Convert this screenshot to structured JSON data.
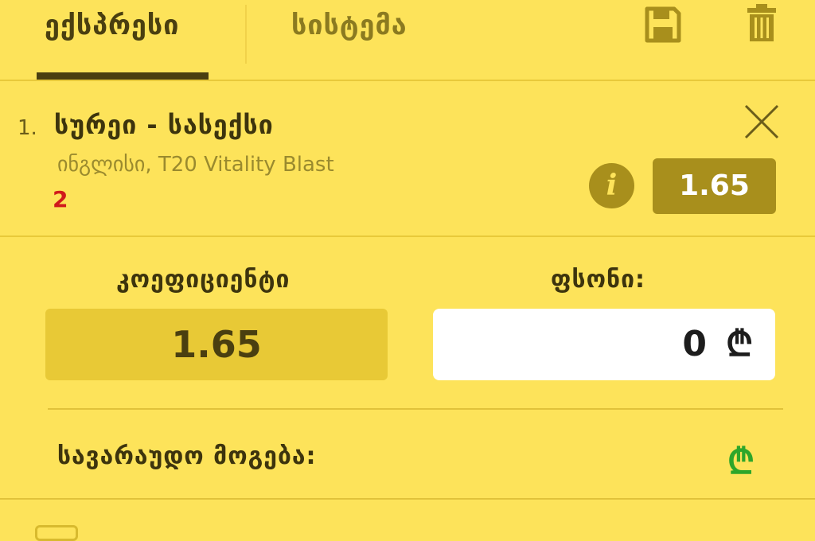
{
  "header": {
    "tabs": [
      {
        "label": "ექსპრესი",
        "active": true
      },
      {
        "label": "სისტემა",
        "active": false
      }
    ],
    "icons": [
      "save-icon",
      "trash-icon"
    ]
  },
  "bet": {
    "number": "1.",
    "title": "სურეი - სასექსი",
    "league": "ინგლისი, T20 Vitality Blast",
    "count": "2",
    "odds": "1.65",
    "info_icon_glyph": "i"
  },
  "coefficient": {
    "label": "კოეფიციენტი",
    "value": "1.65"
  },
  "stake": {
    "label": "ფსონი:",
    "value": "0",
    "currency": "₾"
  },
  "potential_win": {
    "label": "სავარაუდო მოგება:",
    "currency": "₾"
  },
  "colors": {
    "background": "#fde35a",
    "accent": "#a88f1c",
    "text_dark": "#3d340d",
    "count_red": "#d01b1b",
    "win_green": "#2ea62a"
  }
}
